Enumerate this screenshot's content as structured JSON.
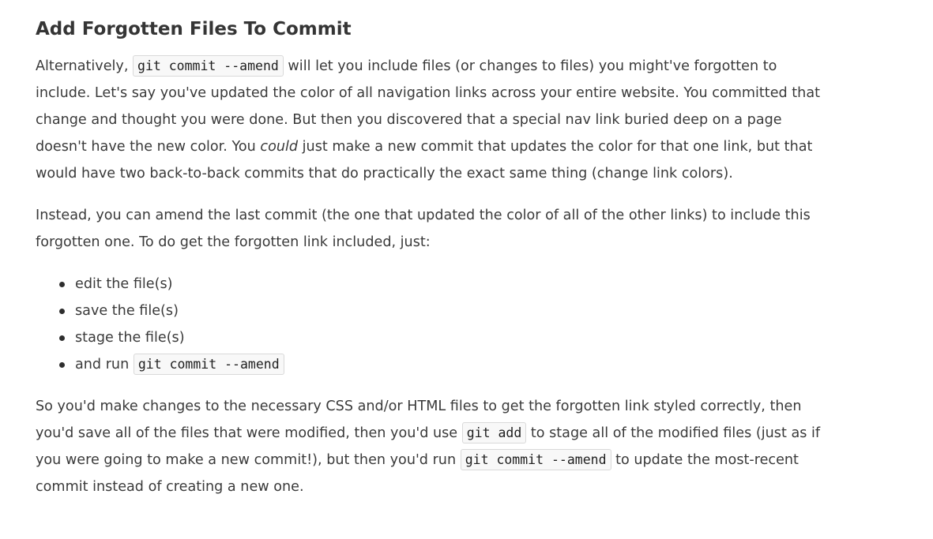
{
  "heading": "Add Forgotten Files To Commit",
  "paragraph1": {
    "before_code": "Alternatively, ",
    "code": "git commit --amend",
    "after_code": " will let you include files (or changes to files) you might've forgotten to include. Let's say you've updated the color of all navigation links across your entire website. You committed that change and thought you were done. But then you discovered that a special nav link buried deep on a page doesn't have the new color. You ",
    "emphasis": "could",
    "after_emphasis": " just make a new commit that updates the color for that one link, but that would have two back-to-back commits that do practically the exact same thing (change link colors)."
  },
  "paragraph2": "Instead, you can amend the last commit (the one that updated the color of all of the other links) to include this forgotten one. To do get the forgotten link included, just:",
  "steps": [
    {
      "text": "edit the file(s)"
    },
    {
      "text": "save the file(s)"
    },
    {
      "text": "stage the file(s)"
    },
    {
      "text": "and run ",
      "code": "git commit --amend"
    }
  ],
  "paragraph3": {
    "part1": "So you'd make changes to the necessary CSS and/or HTML files to get the forgotten link styled correctly, then you'd save all of the files that were modified, then you'd use ",
    "code1": "git add",
    "part2": " to stage all of the modified files (just as if you were going to make a new commit!), but then you'd run ",
    "code2": "git commit --amend",
    "part3": " to update the most-recent commit instead of creating a new one."
  }
}
